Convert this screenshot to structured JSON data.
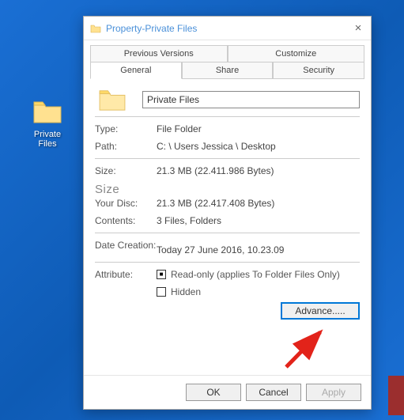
{
  "desktop": {
    "folder_label": "Private Files"
  },
  "dialog": {
    "title": "Property-Private Files",
    "tabs": {
      "previous_versions": "Previous Versions",
      "customize": "Customize",
      "general": "General",
      "share": "Share",
      "security": "Security"
    },
    "name_value": "Private Files",
    "type_label": "Type:",
    "type_value": "File Folder",
    "path_label": "Path:",
    "path_value": "C: \\ Users Jessica \\ Desktop",
    "size_label": "Size:",
    "size_value": "21.3 MB (22.411.986 Bytes)",
    "size_big": "Size",
    "disc_label": "Your Disc:",
    "disc_value": "21.3 MB (22.417.408 Bytes)",
    "contents_label": "Contents:",
    "contents_value": "3 Files, Folders",
    "date_label": "Date Creation:",
    "date_value": "Today 27 June 2016, 10.23.09",
    "attr_label": "Attribute:",
    "readonly_label": "Read-only (applies To Folder Files Only)",
    "hidden_label": "Hidden",
    "advanced_btn": "Advance.....",
    "ok": "OK",
    "cancel": "Cancel",
    "apply": "Apply"
  }
}
